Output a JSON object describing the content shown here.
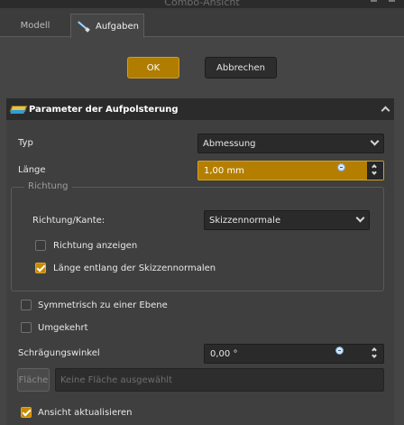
{
  "window": {
    "title": "Combo-Ansicht"
  },
  "tabs": [
    {
      "label": "Modell",
      "active": false
    },
    {
      "label": "Aufgaben",
      "active": true
    }
  ],
  "dialog_buttons": {
    "ok_label": "OK",
    "cancel_label": "Abbrechen"
  },
  "panel": {
    "title": "Parameter der Aufpolsterung",
    "fields": {
      "type_label": "Typ",
      "type_value": "Abmessung",
      "length_label": "Länge",
      "length_value": "1,00 mm",
      "direction_group_title": "Richtung",
      "direction_edge_label": "Richtung/Kante:",
      "direction_edge_value": "Skizzennormale",
      "show_direction_label": "Richtung anzeigen",
      "show_direction_checked": false,
      "along_normal_label": "Länge entlang der Skizzennormalen",
      "along_normal_checked": true,
      "symmetric_label": "Symmetrisch zu einer Ebene",
      "symmetric_checked": false,
      "reversed_label": "Umgekehrt",
      "reversed_checked": false,
      "taper_label": "Schrägungswinkel",
      "taper_value": "0,00 °",
      "face_button_label": "Fläche",
      "face_placeholder": "Keine Fläche ausgewählt",
      "update_view_label": "Ansicht aktualisieren",
      "update_view_checked": true
    }
  },
  "colors": {
    "accent": "#b47f00",
    "background": "#454545",
    "panel": "#3f3f3f",
    "header": "#2b2b2b"
  }
}
